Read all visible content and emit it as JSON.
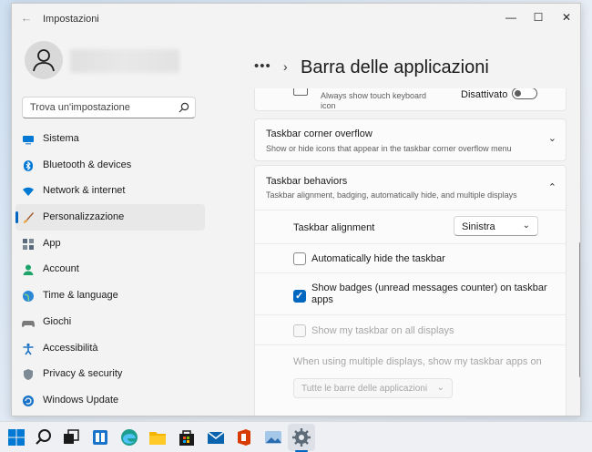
{
  "window": {
    "title": "Impostazioni",
    "back_icon": "arrow-left-icon",
    "controls": {
      "minimize": "—",
      "maximize": "☐",
      "close": "✕"
    }
  },
  "profile": {
    "avatar_icon": "person-icon"
  },
  "search": {
    "placeholder": "Trova un'impostazione",
    "icon": "search-icon"
  },
  "nav": {
    "items": [
      {
        "label": "Sistema",
        "icon": "system-icon",
        "color": "#0078d4"
      },
      {
        "label": "Bluetooth & devices",
        "icon": "bluetooth-icon",
        "color": "#0078d4"
      },
      {
        "label": "Network & internet",
        "icon": "wifi-icon",
        "color": "#0078d4"
      },
      {
        "label": "Personalizzazione",
        "icon": "brush-icon",
        "color": "#e8a33c",
        "active": true
      },
      {
        "label": "App",
        "icon": "apps-icon",
        "color": "#5a6b7d"
      },
      {
        "label": "Account",
        "icon": "account-icon",
        "color": "#1ea46a"
      },
      {
        "label": "Time & language",
        "icon": "globe-icon",
        "color": "#2b88d8"
      },
      {
        "label": "Giochi",
        "icon": "gamepad-icon",
        "color": "#7a7a7a"
      },
      {
        "label": "Accessibilità",
        "icon": "accessibility-icon",
        "color": "#1a73c8"
      },
      {
        "label": "Privacy & security",
        "icon": "shield-icon",
        "color": "#7d8a96"
      },
      {
        "label": "Windows Update",
        "icon": "update-icon",
        "color": "#1a73c8"
      }
    ]
  },
  "header": {
    "dots": "•••",
    "chevron": "›",
    "title": "Barra delle applicazioni"
  },
  "touch_keyboard": {
    "description": "Always show touch keyboard icon",
    "toggle_label": "Disattivato",
    "toggle_on": false
  },
  "overflow": {
    "title": "Taskbar corner overflow",
    "subtitle": "Show or hide icons that appear in the taskbar corner overflow menu",
    "chevron": "⌄"
  },
  "behaviors": {
    "title": "Taskbar behaviors",
    "subtitle": "Taskbar alignment, badging, automatically hide, and multiple displays",
    "chevron": "⌃",
    "alignment_label": "Taskbar alignment",
    "alignment_value": "Sinistra",
    "auto_hide_label": "Automatically hide the taskbar",
    "auto_hide_checked": false,
    "badges_label": "Show badges (unread messages counter) on taskbar apps",
    "badges_checked": true,
    "all_displays_label": "Show my taskbar on all displays",
    "all_displays_checked": false,
    "multi_display_label": "When using multiple displays, show my taskbar apps on",
    "multi_display_value": "Tutte le barre delle applicazioni"
  },
  "taskbar": {
    "icons": [
      "windows-start-icon",
      "search-icon",
      "task-view-icon",
      "widgets-icon",
      "edge-icon",
      "file-explorer-icon",
      "store-icon",
      "mail-icon",
      "office-icon",
      "photos-icon",
      "settings-icon"
    ],
    "active": "settings-icon",
    "accent": "#0067c0"
  }
}
